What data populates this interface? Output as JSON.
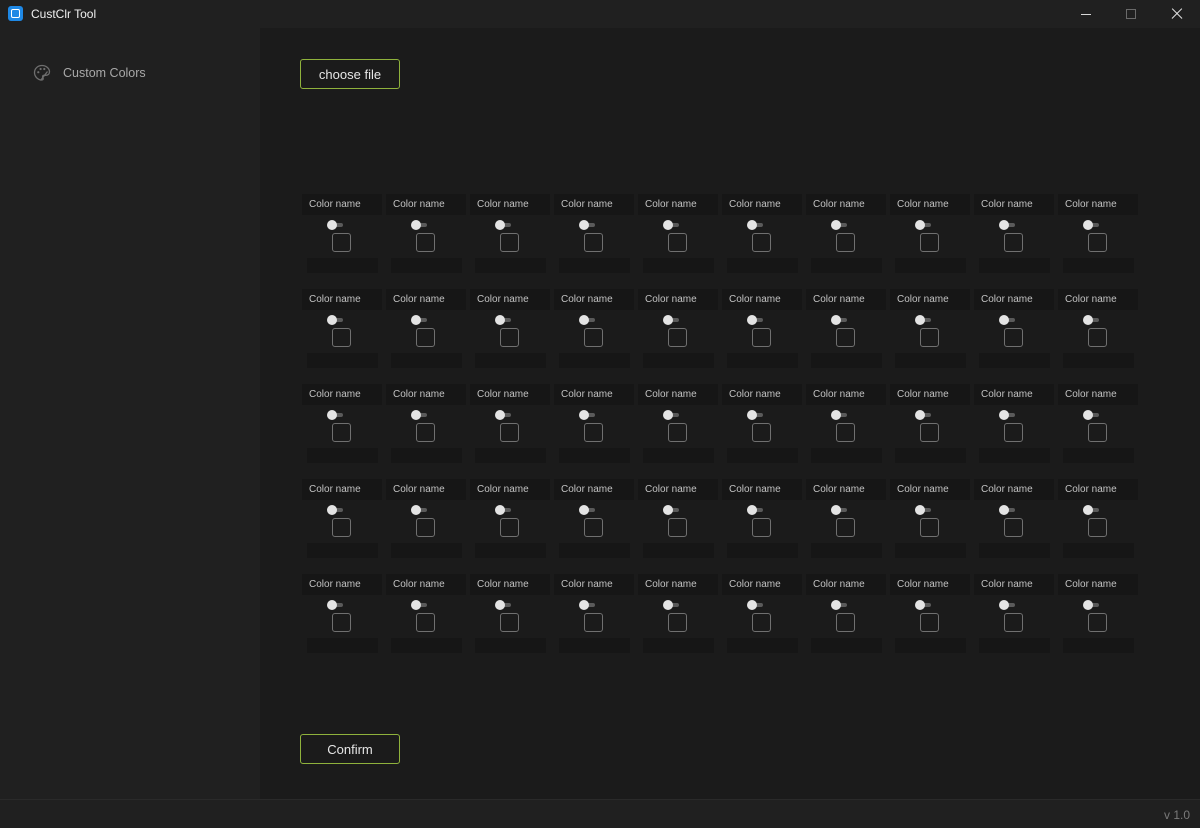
{
  "window": {
    "title": "CustClr Tool"
  },
  "sidebar": {
    "items": [
      {
        "label": "Custom Colors",
        "icon": "palette-icon"
      }
    ]
  },
  "main": {
    "choose_file_label": "choose file",
    "confirm_label": "Confirm",
    "grid": {
      "rows": 5,
      "columns": 10,
      "cell_name_label": "Color name"
    }
  },
  "statusbar": {
    "version": "v 1.0"
  },
  "colors": {
    "accent": "#8fb23c",
    "app_icon": "#1e88e5",
    "background": "#202020",
    "panel": "#1b1b1b"
  }
}
